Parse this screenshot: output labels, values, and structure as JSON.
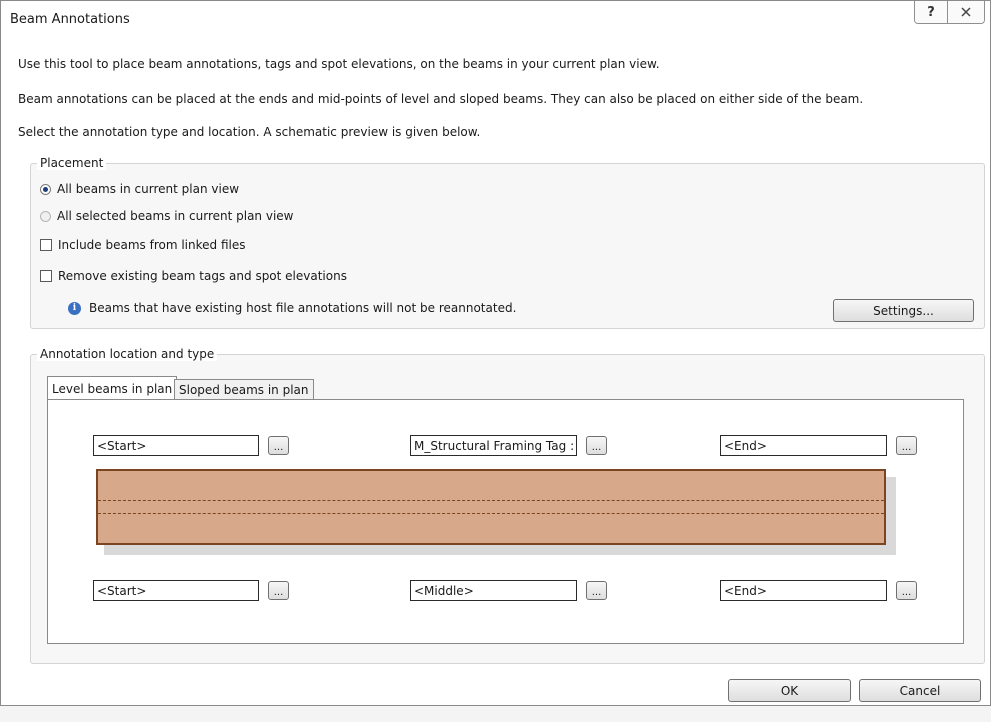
{
  "window": {
    "title": "Beam Annotations",
    "help_glyph": "?"
  },
  "intro": [
    "Use this tool to place beam annotations, tags and spot elevations, on the beams in your current plan view.",
    "Beam annotations can be placed at the ends and mid-points of level and sloped beams.  They can also be placed on either side of the beam.",
    "Select the annotation type and location.  A schematic preview is given below."
  ],
  "placement": {
    "legend": "Placement",
    "radio_all": "All beams in current plan view",
    "radio_selected": "All selected beams in current plan view",
    "check_linked": "Include beams from linked files",
    "check_remove": "Remove existing beam tags and spot elevations",
    "note": "Beams that have existing host file annotations will not be reannotated.",
    "settings_label": "Settings..."
  },
  "annotation": {
    "legend": "Annotation location and type",
    "tabs": [
      "Level beams in plan",
      "Sloped beams in plan"
    ],
    "top": {
      "start": "<Start>",
      "middle": "M_Structural Framing Tag : Standard",
      "end": "<End>"
    },
    "bottom": {
      "start": "<Start>",
      "middle": "<Middle>",
      "end": "<End>"
    },
    "browse_label": "..."
  },
  "footer": {
    "ok_label": "OK",
    "cancel_label": "Cancel"
  },
  "colors": {
    "beam_fill": "#d8a88a",
    "beam_border": "#7a4520"
  }
}
